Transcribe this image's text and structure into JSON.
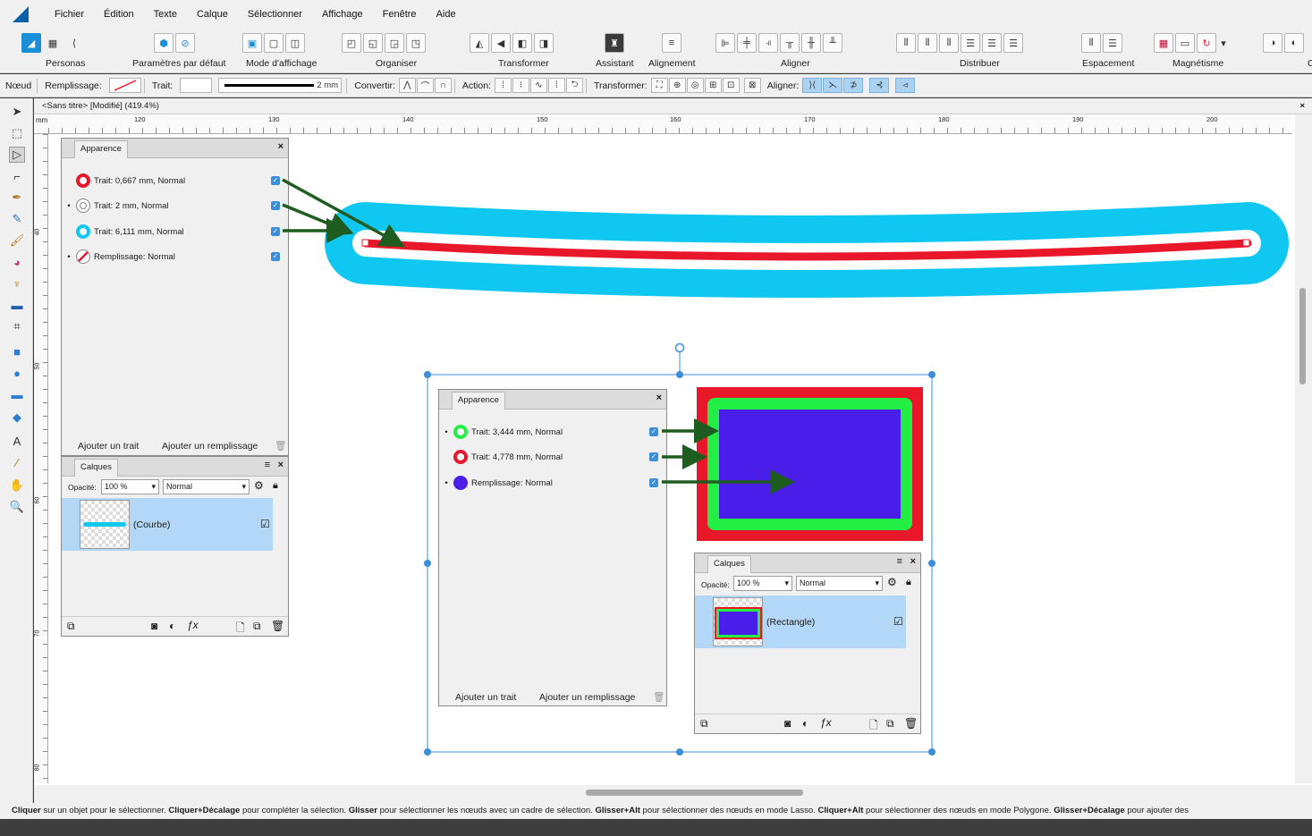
{
  "menu": [
    "Fichier",
    "Édition",
    "Texte",
    "Calque",
    "Sélectionner",
    "Affichage",
    "Fenêtre",
    "Aide"
  ],
  "toolbar": {
    "labels": {
      "personas": "Personas",
      "defaults": "Paramètres par défaut",
      "view_mode": "Mode d'affichage",
      "arrange": "Organiser",
      "transform": "Transformer",
      "assistant": "Assistant",
      "alignment": "Alignement",
      "align": "Aligner",
      "distribute": "Distribuer",
      "spacing": "Espacement",
      "snapping": "Magnétisme",
      "cut": "C"
    }
  },
  "context": {
    "node": "Nœud",
    "fill": "Remplissage:",
    "stroke": "Trait:",
    "stroke_width": "2 mm",
    "convert": "Convertir:",
    "action": "Action:",
    "transform": "Transformer:",
    "align": "Aligner:"
  },
  "document": {
    "tab_title": "<Sans titre> [Modifié] (419.4%)",
    "ruler_unit": "mm",
    "ruler_ticks": [
      "120",
      "130",
      "140",
      "150",
      "160",
      "170",
      "180",
      "190",
      "200"
    ],
    "vruler_ticks": [
      "40",
      "50",
      "60",
      "70",
      "80"
    ]
  },
  "appearance_top": {
    "title": "Apparence",
    "rows": [
      {
        "text": "Trait: 0,667 mm,  Normal",
        "color": "#e8172a"
      },
      {
        "text": "Trait: 2 mm,  Normal",
        "color": "#ffffff"
      },
      {
        "text": "Trait: 6,111 mm,  Normal",
        "color": "#0fc7f0"
      },
      {
        "text": "Remplissage:  Normal",
        "color": "none"
      }
    ],
    "add_stroke": "Ajouter un trait",
    "add_fill": "Ajouter un remplissage"
  },
  "layers_top": {
    "title": "Calques",
    "opacity_label": "Opacité:",
    "opacity": "100 %",
    "blend": "Normal",
    "layer_name": "(Courbe)"
  },
  "appearance_bottom": {
    "title": "Apparence",
    "rows": [
      {
        "text": "Trait: 3,444 mm,  Normal",
        "color": "#22ee44"
      },
      {
        "text": "Trait: 4,778 mm,  Normal",
        "color": "#e8172a"
      },
      {
        "text": "Remplissage:  Normal",
        "color": "#4a1ee8"
      }
    ],
    "add_stroke": "Ajouter un trait",
    "add_fill": "Ajouter un remplissage"
  },
  "layers_bottom": {
    "title": "Calques",
    "opacity_label": "Opacité:",
    "opacity": "100 %",
    "blend": "Normal",
    "layer_name": "(Rectangle)"
  },
  "status": {
    "segments": [
      {
        "b": "Cliquer",
        "t": " sur un objet pour le sélectionner. "
      },
      {
        "b": "Cliquer+Décalage",
        "t": " pour compléter la sélection. "
      },
      {
        "b": "Glisser",
        "t": " pour sélectionner les nœuds avec un cadre de sélection. "
      },
      {
        "b": "Glisser+Alt",
        "t": " pour sélectionner des nœuds en mode Lasso. "
      },
      {
        "b": "Cliquer+Alt",
        "t": " pour sélectionner des nœuds en mode Polygone. "
      },
      {
        "b": "Glisser+Décalage",
        "t": " pour ajouter des"
      }
    ]
  },
  "colors": {
    "accent": "#3b8fd8",
    "arrow": "#1f5c1f",
    "cyan": "#0fc7f0",
    "red": "#e8172a",
    "green": "#22ee44",
    "purple": "#4a1ee8"
  }
}
